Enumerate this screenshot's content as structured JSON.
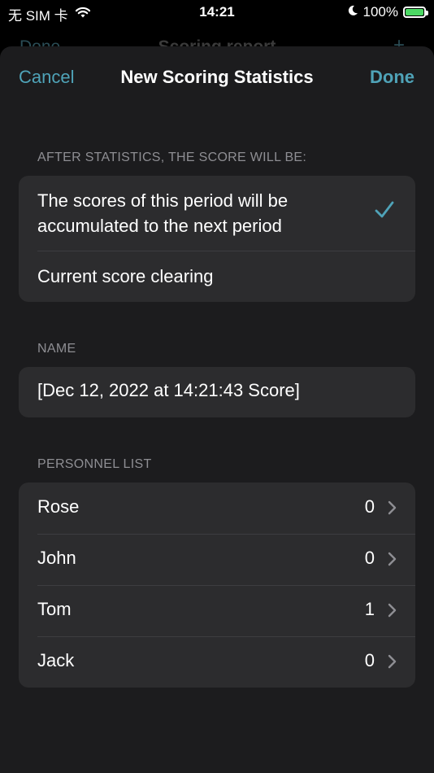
{
  "status_bar": {
    "carrier": "无 SIM 卡",
    "time": "14:21",
    "battery": "100%"
  },
  "behind": {
    "left": "Done",
    "title": "Scoring report",
    "right": "+"
  },
  "nav": {
    "cancel": "Cancel",
    "title": "New Scoring Statistics",
    "done": "Done"
  },
  "after_stats": {
    "header": "AFTER STATISTICS, THE SCORE WILL BE:",
    "options": [
      {
        "label": "The scores of this period will be accumulated to the next period",
        "selected": true
      },
      {
        "label": "Current score clearing",
        "selected": false
      }
    ]
  },
  "name": {
    "header": "NAME",
    "value": "[Dec 12, 2022 at 14:21:43 Score]"
  },
  "personnel": {
    "header": "PERSONNEL LIST",
    "people": [
      {
        "name": "Rose",
        "score": "0"
      },
      {
        "name": "John",
        "score": "0"
      },
      {
        "name": "Tom",
        "score": "1"
      },
      {
        "name": "Jack",
        "score": "0"
      }
    ]
  },
  "colors": {
    "accent": "#4fa3b8",
    "background": "#000000",
    "sheet": "#1c1c1e",
    "group": "#2c2c2e",
    "battery": "#4cd964"
  }
}
